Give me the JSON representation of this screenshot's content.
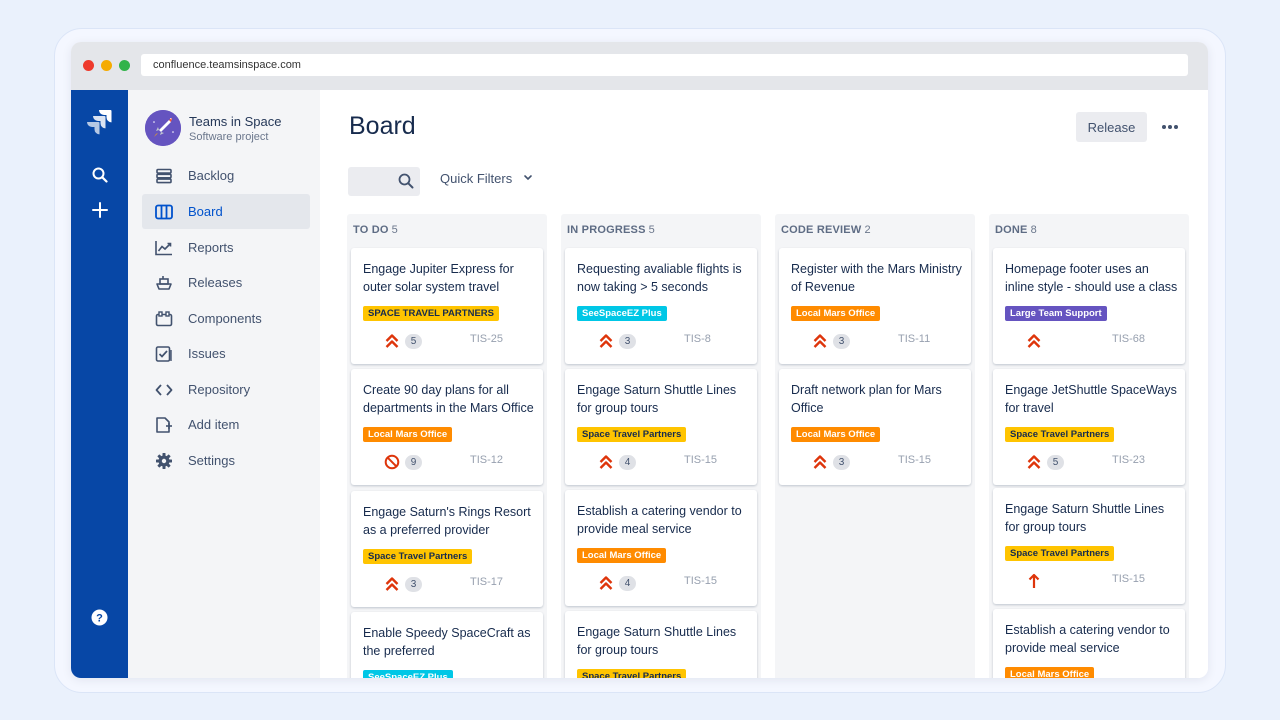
{
  "browser": {
    "url": "confluence.teamsinspace.com"
  },
  "global_nav": {
    "icons": [
      "jira-logo-icon",
      "search-icon",
      "create-icon",
      "help-icon"
    ]
  },
  "project": {
    "name": "Teams in Space",
    "type": "Software project"
  },
  "sidebar": {
    "items": [
      {
        "label": "Backlog",
        "icon": "backlog-icon"
      },
      {
        "label": "Board",
        "icon": "board-icon",
        "active": true
      },
      {
        "label": "Reports",
        "icon": "reports-icon"
      },
      {
        "label": "Releases",
        "icon": "releases-icon"
      },
      {
        "label": "Components",
        "icon": "components-icon"
      },
      {
        "label": "Issues",
        "icon": "issues-icon"
      },
      {
        "label": "Repository",
        "icon": "repository-icon"
      },
      {
        "label": "Add item",
        "icon": "add-item-icon"
      },
      {
        "label": "Settings",
        "icon": "settings-icon"
      }
    ]
  },
  "header": {
    "title": "Board",
    "release_label": "Release",
    "quick_filters_label": "Quick Filters"
  },
  "colors": {
    "nav_blue": "#0747a6",
    "tag_yellow": "#ffc400",
    "tag_orange": "#ff8b00",
    "tag_cyan": "#00c7e6",
    "tag_purple": "#6554c0",
    "priority_red": "#de350b"
  },
  "columns": [
    {
      "title": "TO DO",
      "count": "5",
      "cards": [
        {
          "title": "Engage Jupiter Express for outer solar system travel",
          "tag": "SPACE TRAVEL PARTNERS",
          "tag_color": "#ffc400",
          "tag_text_color": "#172b4d",
          "priority": "highest",
          "points": "5",
          "key": "TIS-25"
        },
        {
          "title": "Create 90 day plans for all departments in the Mars Office",
          "tag": "Local Mars Office",
          "tag_color": "#ff8b00",
          "tag_text_color": "#ffffff",
          "priority": "blocker",
          "points": "9",
          "key": "TIS-12"
        },
        {
          "title": "Engage Saturn's Rings Resort as a preferred provider",
          "tag": "Space Travel Partners",
          "tag_color": "#ffc400",
          "tag_text_color": "#172b4d",
          "priority": "highest",
          "points": "3",
          "key": "TIS-17"
        },
        {
          "title": "Enable Speedy SpaceCraft as the preferred",
          "tag": "SeeSpaceEZ Plus",
          "tag_color": "#00c7e6",
          "tag_text_color": "#ffffff",
          "priority": "",
          "points": "",
          "key": ""
        }
      ]
    },
    {
      "title": "IN PROGRESS",
      "count": "5",
      "cards": [
        {
          "title": "Requesting avaliable flights is now taking > 5 seconds",
          "tag": "SeeSpaceEZ Plus",
          "tag_color": "#00c7e6",
          "tag_text_color": "#ffffff",
          "priority": "highest",
          "points": "3",
          "key": "TIS-8"
        },
        {
          "title": "Engage Saturn Shuttle Lines for group tours",
          "tag": "Space Travel Partners",
          "tag_color": "#ffc400",
          "tag_text_color": "#172b4d",
          "priority": "highest",
          "points": "4",
          "key": "TIS-15"
        },
        {
          "title": "Establish a catering vendor to provide meal service",
          "tag": "Local Mars Office",
          "tag_color": "#ff8b00",
          "tag_text_color": "#ffffff",
          "priority": "highest",
          "points": "4",
          "key": "TIS-15"
        },
        {
          "title": "Engage Saturn Shuttle Lines for group tours",
          "tag": "Space Travel Partners",
          "tag_color": "#ffc400",
          "tag_text_color": "#172b4d",
          "priority": "",
          "points": "",
          "key": ""
        }
      ]
    },
    {
      "title": "CODE REVIEW",
      "count": "2",
      "cards": [
        {
          "title": "Register with the Mars Ministry of Revenue",
          "tag": "Local Mars Office",
          "tag_color": "#ff8b00",
          "tag_text_color": "#ffffff",
          "priority": "highest",
          "points": "3",
          "key": "TIS-11"
        },
        {
          "title": "Draft network plan for Mars Office",
          "tag": "Local Mars Office",
          "tag_color": "#ff8b00",
          "tag_text_color": "#ffffff",
          "priority": "highest",
          "points": "3",
          "key": "TIS-15"
        }
      ]
    },
    {
      "title": "DONE",
      "count": "8",
      "cards": [
        {
          "title": "Homepage footer uses an inline style - should use a class",
          "tag": "Large Team Support",
          "tag_color": "#6554c0",
          "tag_text_color": "#ffffff",
          "priority": "highest",
          "points": "",
          "key": "TIS-68"
        },
        {
          "title": "Engage JetShuttle SpaceWays for travel",
          "tag": "Space Travel Partners",
          "tag_color": "#ffc400",
          "tag_text_color": "#172b4d",
          "priority": "highest",
          "points": "5",
          "key": "TIS-23"
        },
        {
          "title": "Engage Saturn Shuttle Lines for group tours",
          "tag": "Space Travel Partners",
          "tag_color": "#ffc400",
          "tag_text_color": "#172b4d",
          "priority": "high",
          "points": "",
          "key": "TIS-15"
        },
        {
          "title": "Establish a catering vendor to provide meal service",
          "tag": "Local Mars Office",
          "tag_color": "#ff8b00",
          "tag_text_color": "#ffffff",
          "priority": "",
          "points": "",
          "key": ""
        }
      ]
    }
  ]
}
